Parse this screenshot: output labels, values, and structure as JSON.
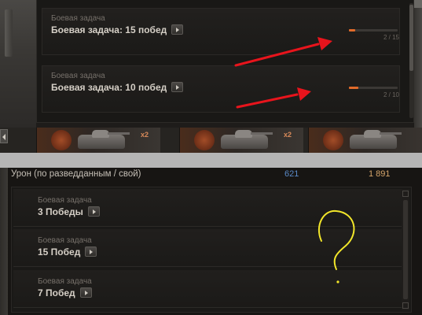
{
  "top_tasks": [
    {
      "subtitle": "Боевая задача",
      "title": "Боевая задача: 15 побед",
      "progress_current": 2,
      "progress_total": 15,
      "progress_text": "2 / 15"
    },
    {
      "subtitle": "Боевая задача",
      "title": "Боевая задача: 10 побед",
      "progress_current": 2,
      "progress_total": 10,
      "progress_text": "2 / 10"
    }
  ],
  "tank_strip": {
    "multiplier_label": "x2",
    "tiles": 3
  },
  "damage_row": {
    "label": "Урон (по разведданным / свой)",
    "spotted_value": "621",
    "own_value": "1 891"
  },
  "bottom_tasks": [
    {
      "subtitle": "Боевая задача",
      "title": "3 Победы"
    },
    {
      "subtitle": "Боевая задача",
      "title": "15 Побед"
    },
    {
      "subtitle": "Боевая задача",
      "title": "7 Побед"
    }
  ],
  "annotation": {
    "arrows_color": "#e8141c",
    "question_mark_color": "#f2e62a",
    "question_mark": "?"
  },
  "colors": {
    "progress_fill": "#e06a2a",
    "spotted_damage": "#5a8ac8",
    "own_damage": "#d6a56a"
  }
}
